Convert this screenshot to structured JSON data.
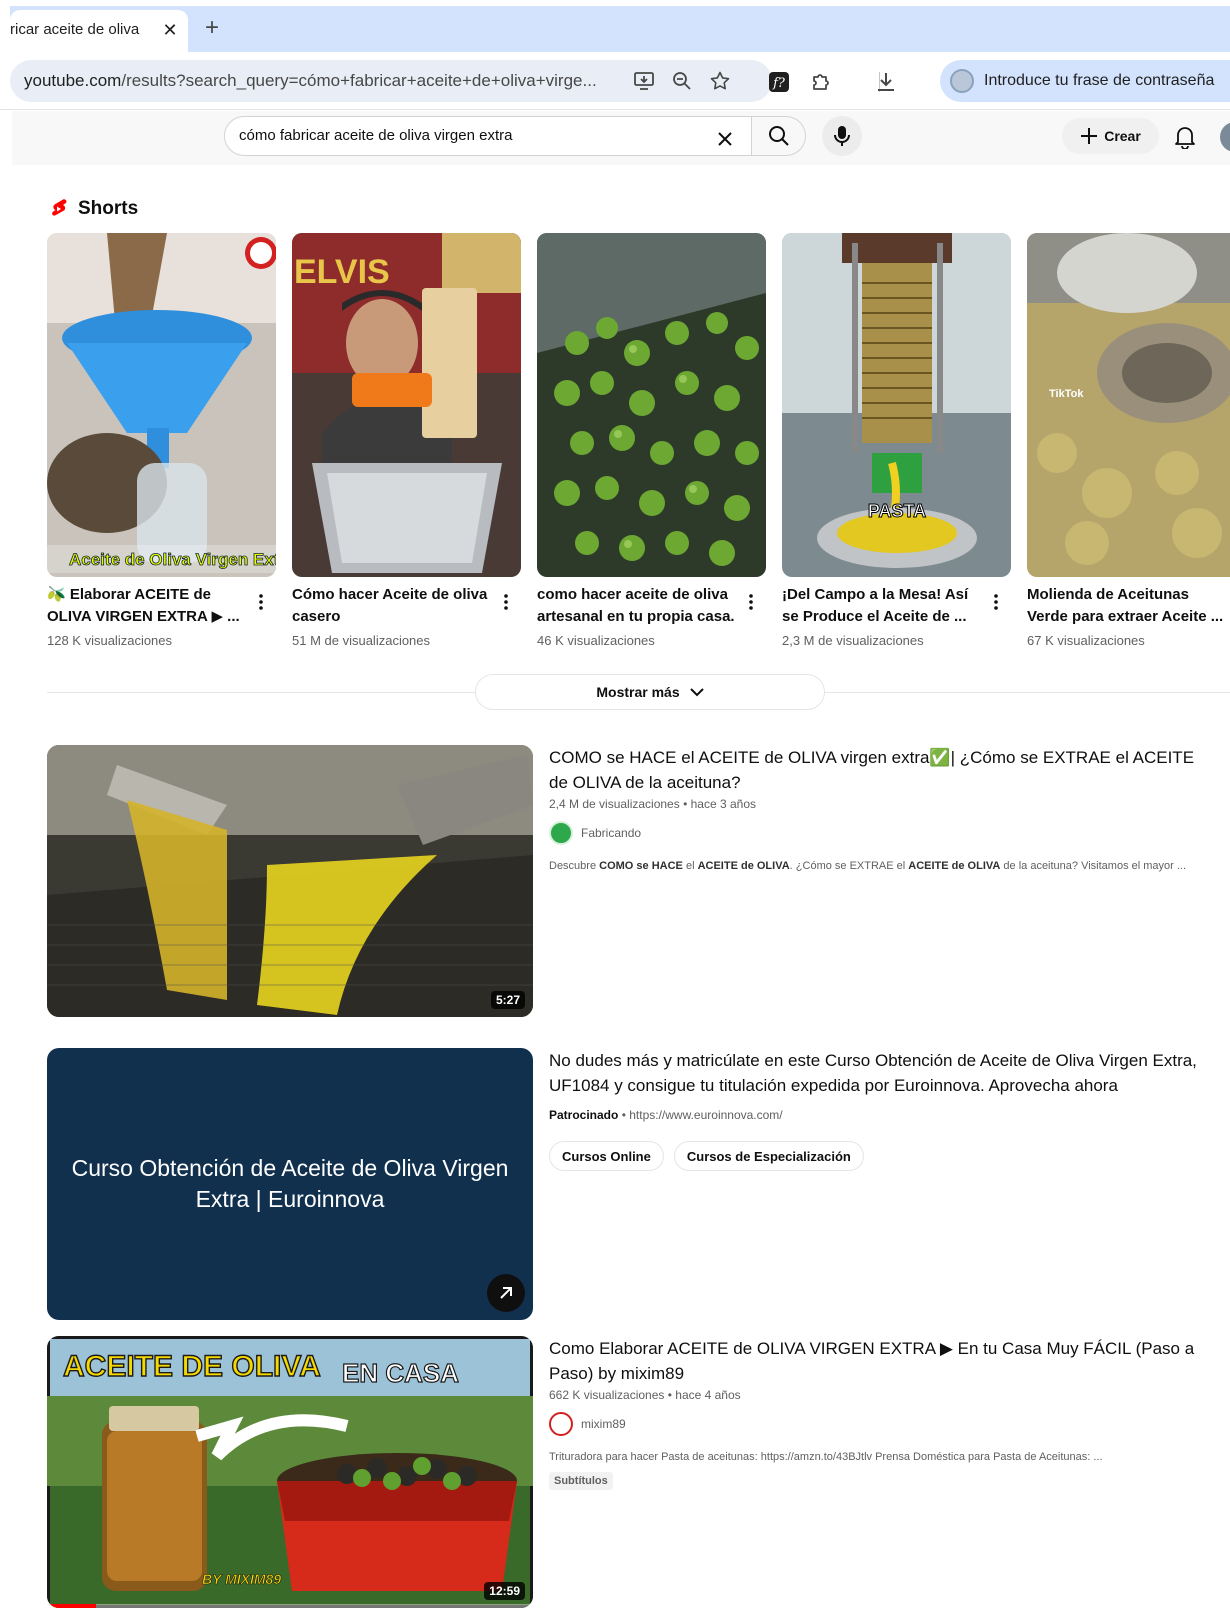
{
  "browser": {
    "tab_title": "ricar aceite de oliva",
    "url_host": "youtube.com",
    "url_path": "/results?search_query=cómo+fabricar+aceite+de+oliva+virge...",
    "profile_prompt": "Introduce tu frase de contraseña"
  },
  "header": {
    "search_query": "cómo fabricar aceite de oliva virgen extra",
    "create_label": "Crear"
  },
  "shorts": {
    "title": "Shorts",
    "items": [
      {
        "title": "🫒 Elaborar ACEITE de OLIVA VIRGEN EXTRA ▶ ...",
        "views": "128 K visualizaciones",
        "overlay": "Aceite de Oliva Virgen Extra"
      },
      {
        "title": "Cómo hacer Aceite de oliva casero",
        "views": "51 M de visualizaciones",
        "overlay": "ELVIS"
      },
      {
        "title": "como hacer aceite de oliva artesanal en tu propia casa.",
        "views": "46 K visualizaciones",
        "overlay": ""
      },
      {
        "title": "¡Del Campo a la Mesa! Así se Produce el Aceite de ...",
        "views": "2,3 M de visualizaciones",
        "overlay": "PASTA"
      },
      {
        "title": "Molienda de Aceitunas Verde para extraer Aceite ...",
        "views": "67 K visualizaciones",
        "overlay": "TikTok"
      }
    ],
    "show_more": "Mostrar más"
  },
  "results": [
    {
      "title": "COMO se HACE el ACEITE de OLIVA virgen extra✅| ¿Cómo se EXTRAE el ACEITE de OLIVA de la aceituna?",
      "meta": "2,4 M de visualizaciones • hace 3 años",
      "channel": "Fabricando",
      "desc_parts": [
        "Descubre ",
        "COMO se HACE",
        " el ",
        "ACEITE de OLIVA",
        ". ¿Cómo se EXTRAE el ",
        "ACEITE de OLIVA",
        " de la aceituna? Visitamos el mayor ..."
      ],
      "duration": "5:27"
    },
    {
      "title": "No dudes más y matricúlate en este Curso Obtención de Aceite de Oliva Virgen Extra, UF1084 y consigue tu titulación expedida por Euroinnova. Aprovecha ahora",
      "sponsored_label": "Patrocinado",
      "sponsored_url": "https://www.euroinnova.com/",
      "chips": [
        "Cursos Online",
        "Cursos de Especialización"
      ],
      "card_headline": "Curso Obtención de Aceite de Oliva Virgen Extra | Euroinnova"
    },
    {
      "title": "Como Elaborar ACEITE de OLIVA VIRGEN EXTRA ▶ En tu Casa Muy FÁCIL (Paso a Paso) by mixim89",
      "meta": "662 K visualizaciones • hace 4 años",
      "channel": "mixim89",
      "desc": "Trituradora para hacer Pasta de aceitunas: https://amzn.to/43BJtlv Prensa Doméstica para Pasta de Aceitunas: ...",
      "badge": "Subtítulos",
      "duration": "12:59",
      "thumb_text_1": "ACEITE DE OLIVA",
      "thumb_text_2": "EN CASA",
      "thumb_text_3": "BY MIXIM89",
      "watch_progress": 0.1
    }
  ],
  "colors": {
    "brand_red": "#ff0000",
    "tab_strip": "#d3e3fd",
    "ad_card": "#10304e"
  }
}
